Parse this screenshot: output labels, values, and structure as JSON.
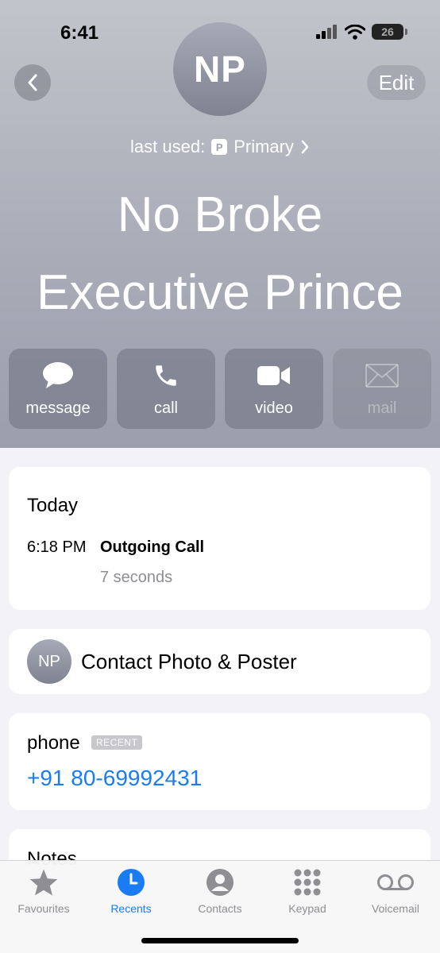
{
  "status_bar": {
    "time": "6:41",
    "battery": "26"
  },
  "header": {
    "edit_label": "Edit",
    "avatar_initials": "NP",
    "last_used_label": "last used:",
    "line_badge": "P",
    "line_name": "Primary",
    "name_line1": "No Broke",
    "name_line2": "Executive Prince"
  },
  "actions": [
    {
      "label": "message",
      "icon": "message-icon",
      "enabled": true
    },
    {
      "label": "call",
      "icon": "phone-icon",
      "enabled": true
    },
    {
      "label": "video",
      "icon": "video-icon",
      "enabled": true
    },
    {
      "label": "mail",
      "icon": "mail-icon",
      "enabled": false
    }
  ],
  "recents": {
    "title": "Today",
    "entries": [
      {
        "time": "6:18 PM",
        "type": "Outgoing Call",
        "duration": "7 seconds"
      }
    ]
  },
  "poster": {
    "initials": "NP",
    "label": "Contact Photo & Poster"
  },
  "phone": {
    "label": "phone",
    "badge": "RECENT",
    "number": "+91 80-69992431"
  },
  "notes": {
    "label": "Notes"
  },
  "tabbar": {
    "tabs": [
      {
        "label": "Favourites",
        "icon": "star-icon",
        "active": false
      },
      {
        "label": "Recents",
        "icon": "clock-icon",
        "active": true
      },
      {
        "label": "Contacts",
        "icon": "person-icon",
        "active": false
      },
      {
        "label": "Keypad",
        "icon": "keypad-icon",
        "active": false
      },
      {
        "label": "Voicemail",
        "icon": "voicemail-icon",
        "active": false
      }
    ]
  },
  "colors": {
    "accent": "#1a7cf2",
    "secondary_text": "#8e8e93",
    "background": "#f2f2f7"
  }
}
